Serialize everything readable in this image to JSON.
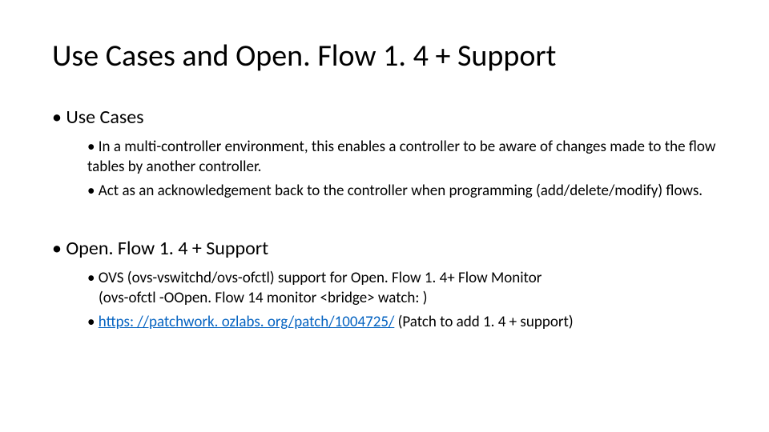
{
  "title": "Use Cases and Open. Flow 1. 4 + Support",
  "section1": {
    "heading": "Use Cases",
    "item1": "In a multi-controller environment, this enables a controller to be aware of changes made to the flow tables by another controller.",
    "item2": "Act as an acknowledgement back to the controller when programming (add/delete/modify) flows."
  },
  "section2": {
    "heading": "Open. Flow 1. 4 + Support",
    "item1_line1": "OVS (ovs-vswitchd/ovs-ofctl) support for Open. Flow 1. 4+ Flow Monitor",
    "item1_line2": " (ovs-ofctl -OOpen. Flow 14 monitor <bridge> watch:  )",
    "item2_link": "https: //patchwork. ozlabs. org/patch/1004725/",
    "item2_suffix": "   (Patch to add 1. 4 + support)"
  }
}
